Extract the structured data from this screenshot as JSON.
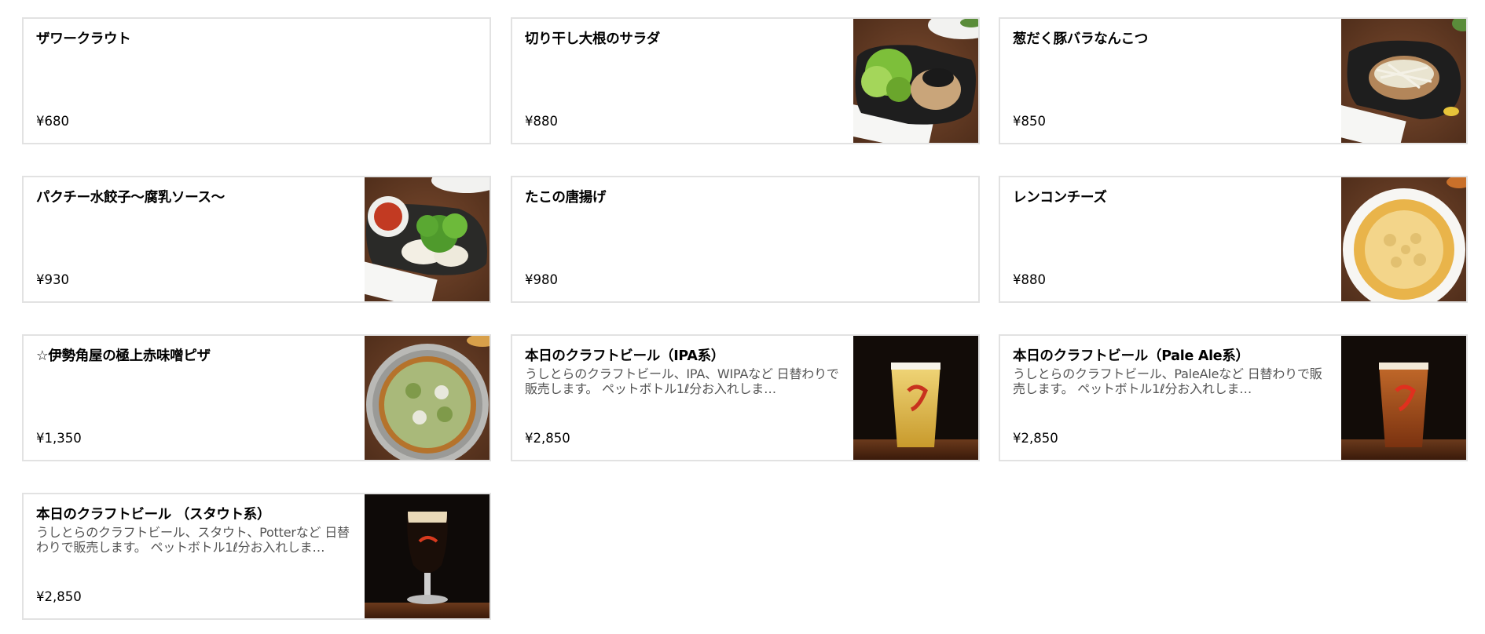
{
  "menu": {
    "items": [
      {
        "title": "ザワークラウト",
        "description": "",
        "price": "¥680",
        "image": "none"
      },
      {
        "title": "切り干し大根のサラダ",
        "description": "",
        "price": "¥880",
        "image": "daikon-salad-photo"
      },
      {
        "title": "葱だく豚バラなんこつ",
        "description": "",
        "price": "¥850",
        "image": "pork-cartilage-photo"
      },
      {
        "title": "パクチー水餃子〜腐乳ソース〜",
        "description": "",
        "price": "¥930",
        "image": "coriander-dumplings-photo"
      },
      {
        "title": "たこの唐揚げ",
        "description": "",
        "price": "¥980",
        "image": "none"
      },
      {
        "title": "レンコンチーズ",
        "description": "",
        "price": "¥880",
        "image": "lotus-cheese-photo"
      },
      {
        "title": "☆伊勢角屋の極上赤味噌ピザ",
        "description": "",
        "price": "¥1,350",
        "image": "miso-pizza-photo"
      },
      {
        "title": "本日のクラフトビール（IPA系）",
        "description": "うしとらのクラフトビール、IPA、WIPAなど 日替わりで販売します。 ペットボトル1ℓ分お入れしま…",
        "price": "¥2,850",
        "image": "ipa-beer-glass-photo"
      },
      {
        "title": "本日のクラフトビール（Pale Ale系）",
        "description": "うしとらのクラフトビール、PaleAleなど 日替わりで販売します。 ペットボトル1ℓ分お入れしま…",
        "price": "¥2,850",
        "image": "pale-ale-beer-glass-photo"
      },
      {
        "title": "本日のクラフトビール （スタウト系）",
        "description": "うしとらのクラフトビール、スタウト、Potterなど 日替わりで販売します。 ペットボトル1ℓ分お入れしま…",
        "price": "¥2,850",
        "image": "stout-beer-glass-photo"
      }
    ]
  },
  "colors": {
    "card_border": "#e2e2e2",
    "description_text": "#545454",
    "title_text": "#000000"
  }
}
